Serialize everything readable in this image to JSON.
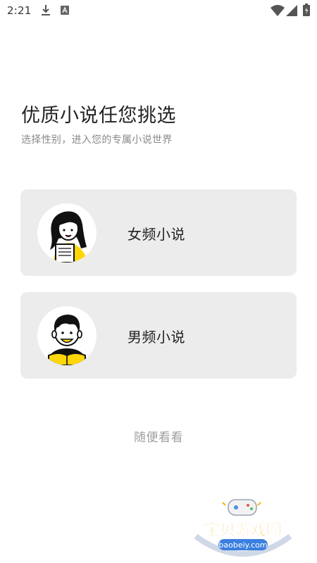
{
  "status_bar": {
    "time": "2:21",
    "icons": [
      "download-icon",
      "a-icon",
      "wifi-icon",
      "signal-icon",
      "battery-icon"
    ]
  },
  "header": {
    "title": "优质小说任您挑选",
    "subtitle": "选择性别，进入您的专属小说世界"
  },
  "options": [
    {
      "label": "女频小说",
      "avatar": "girl-reading-avatar"
    },
    {
      "label": "男频小说",
      "avatar": "boy-reading-avatar"
    }
  ],
  "skip": {
    "label": "随便看看"
  },
  "watermark": {
    "title": "宝贝游戏网",
    "url": "baobeiy.com"
  },
  "colors": {
    "card_bg": "#ececec",
    "accent_yellow": "#ffd60a",
    "title": "#222222",
    "subtitle": "#8a8a8a",
    "skip": "#9e9e9e"
  }
}
